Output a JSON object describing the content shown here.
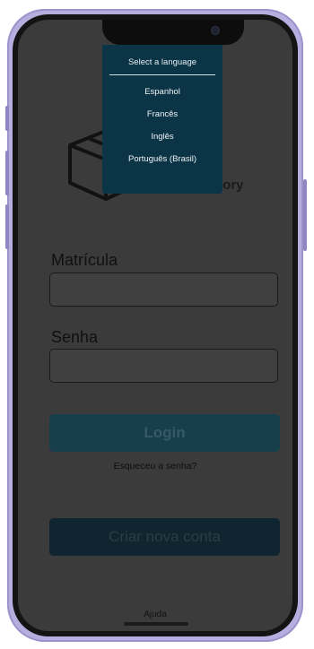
{
  "language_menu": {
    "title": "Select a language",
    "options": [
      "Espanhol",
      "Francês",
      "Inglês",
      "Português (Brasil)"
    ]
  },
  "logo": {
    "letters": "C",
    "subtitle": "Inventory"
  },
  "form": {
    "matricula_label": "Matrícula",
    "matricula_value": "",
    "senha_label": "Senha",
    "senha_value": "",
    "login_label": "Login",
    "forgot_label": "Esqueceu a senha?",
    "create_account_label": "Criar nova conta"
  },
  "footer": {
    "help_label": "Ajuda"
  },
  "colors": {
    "menu_background": "#0b3546",
    "login_button": "#173e4b",
    "create_button": "#0f2530",
    "overlay": "#3b3b3b"
  }
}
